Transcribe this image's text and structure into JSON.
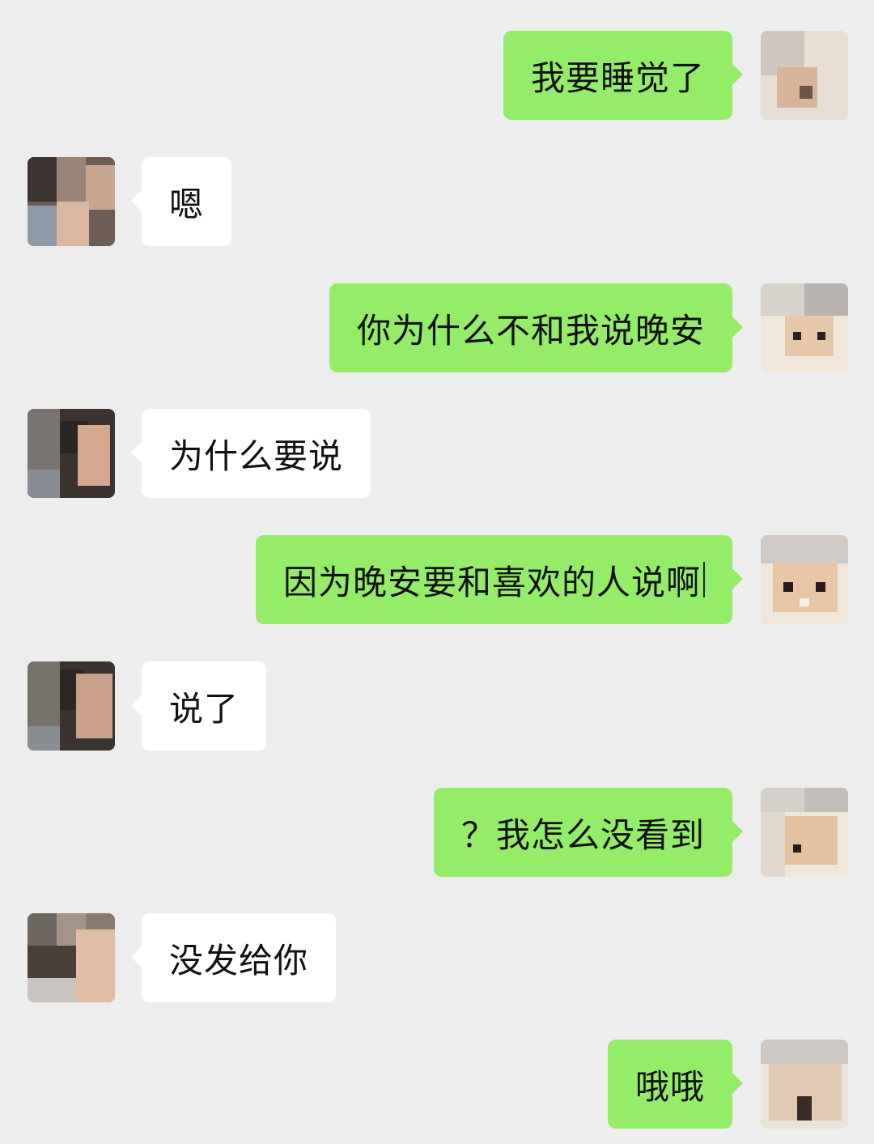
{
  "conversation": {
    "messages": [
      {
        "side": "right",
        "text": "我要睡觉了",
        "avatar": "kitten-avatar"
      },
      {
        "side": "left",
        "text": "嗯",
        "avatar": "contact-avatar"
      },
      {
        "side": "right",
        "text": "你为什么不和我说晚安",
        "avatar": "kitten-avatar"
      },
      {
        "side": "left",
        "text": "为什么要说",
        "avatar": "contact-avatar"
      },
      {
        "side": "right",
        "text": "因为晚安要和喜欢的人说啊",
        "avatar": "kitten-avatar",
        "caret": true
      },
      {
        "side": "left",
        "text": "说了",
        "avatar": "contact-avatar"
      },
      {
        "side": "right",
        "text": "？我怎么没看到",
        "avatar": "kitten-avatar"
      },
      {
        "side": "left",
        "text": "没发给你",
        "avatar": "contact-avatar"
      },
      {
        "side": "right",
        "text": "哦哦",
        "avatar": "kitten-avatar"
      }
    ]
  },
  "colors": {
    "background": "#ededed",
    "sent_bubble": "#95ec69",
    "received_bubble": "#ffffff",
    "text": "#111111"
  }
}
